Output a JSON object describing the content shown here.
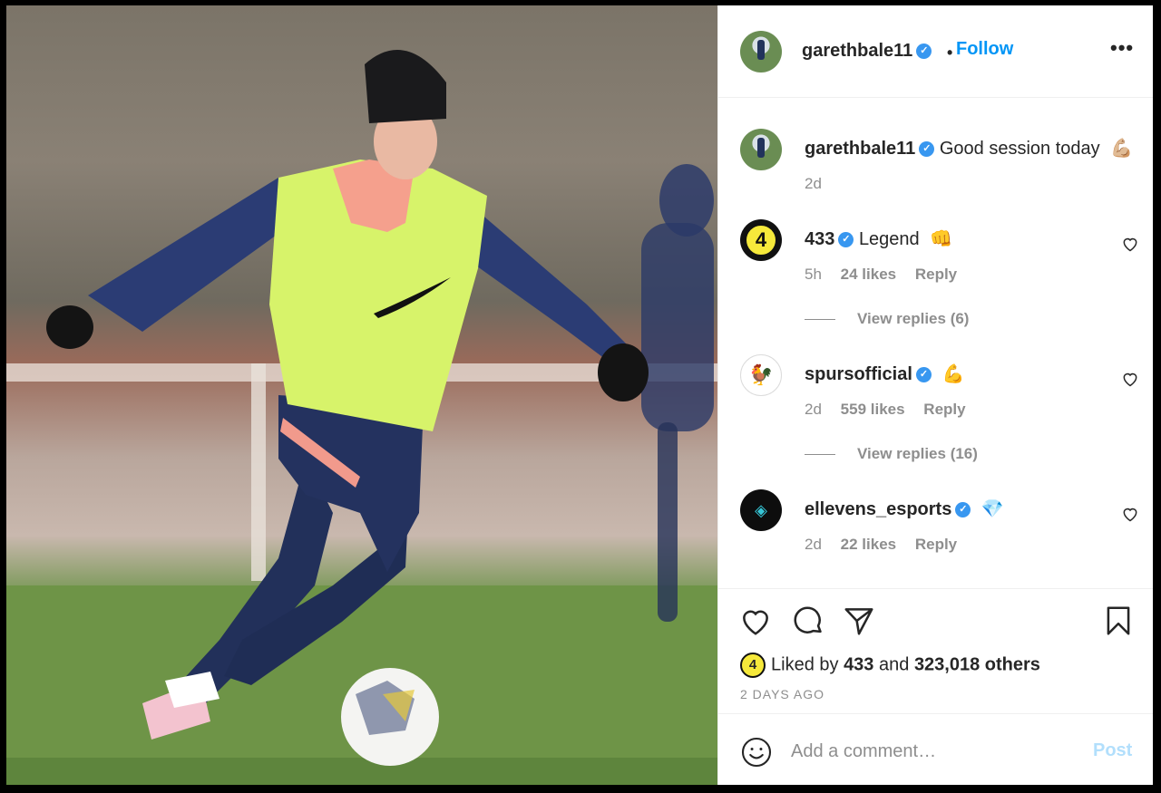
{
  "post": {
    "author": "garethbale11",
    "follow_label": "Follow",
    "separator": "•",
    "more_label": "•••"
  },
  "caption": {
    "username": "garethbale11",
    "text": "Good session today",
    "emoji": "💪🏼",
    "time": "2d"
  },
  "comments": [
    {
      "username": "433",
      "text": "Legend",
      "emoji": "👊",
      "time": "5h",
      "likes": "24 likes",
      "reply": "Reply",
      "view_replies": "View replies (6)",
      "avatar_text": "4"
    },
    {
      "username": "spursofficial",
      "text": "",
      "emoji": "💪",
      "time": "2d",
      "likes": "559 likes",
      "reply": "Reply",
      "view_replies": "View replies (16)",
      "avatar_text": "🐓"
    },
    {
      "username": "ellevens_esports",
      "text": "",
      "emoji": "💎",
      "time": "2d",
      "likes": "22 likes",
      "reply": "Reply",
      "avatar_text": "◈"
    }
  ],
  "likes": {
    "prefix": "Liked by",
    "user": "433",
    "joiner": "and",
    "others": "323,018 others",
    "avatar_text": "4"
  },
  "timestamp": "2 DAYS AGO",
  "composer": {
    "placeholder": "Add a comment…",
    "post_label": "Post"
  },
  "icons": [
    "heart-icon",
    "comment-icon",
    "share-icon",
    "bookmark-icon",
    "smile-icon",
    "verified-icon",
    "more-icon"
  ],
  "colors": {
    "link_blue": "#0095f6",
    "verified_blue": "#3897f0",
    "muted": "#8e8e8e",
    "post_disabled": "#b2dffc"
  }
}
